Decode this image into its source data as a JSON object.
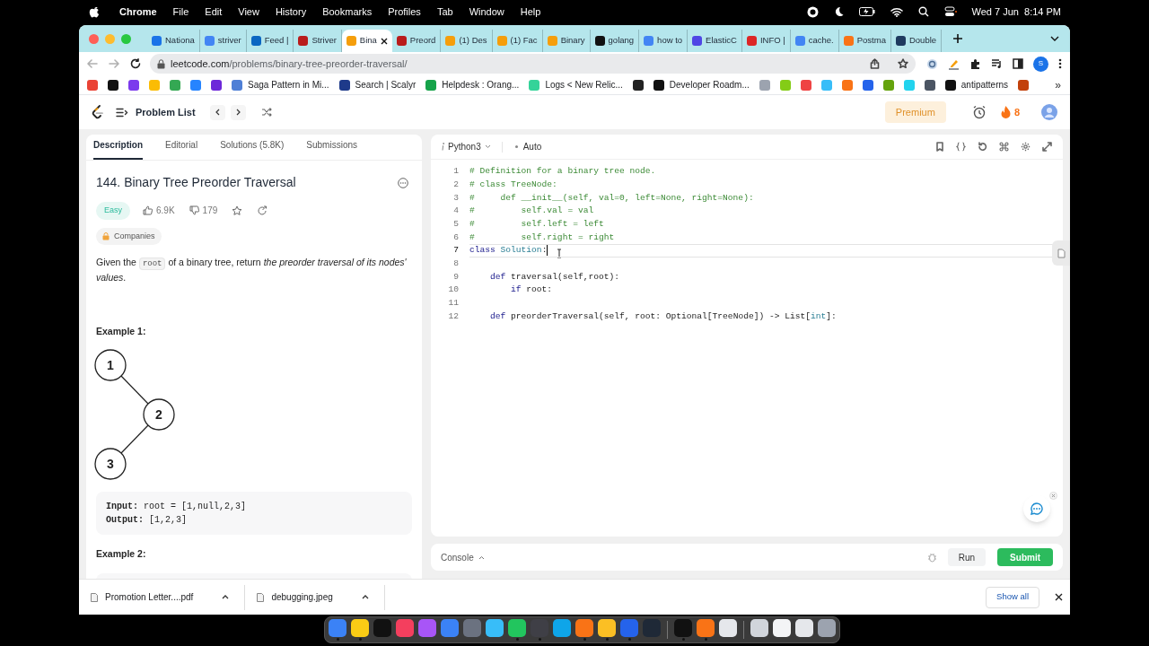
{
  "menu_bar": {
    "app": "Chrome",
    "menus": [
      "File",
      "Edit",
      "View",
      "History",
      "Bookmarks",
      "Profiles",
      "Tab",
      "Window",
      "Help"
    ],
    "clock": "Wed 7 Jun  8:14 PM"
  },
  "browser": {
    "tabs": [
      {
        "label": "Nationa",
        "color": "#1a73e8",
        "selected": false
      },
      {
        "label": "striver",
        "color": "#4285f4",
        "selected": false
      },
      {
        "label": "Feed |",
        "color": "#0a66c2",
        "selected": false
      },
      {
        "label": "Striver",
        "color": "#b91c1c",
        "selected": false
      },
      {
        "label": "Bina",
        "color": "#f59e0b",
        "selected": true
      },
      {
        "label": "Preord",
        "color": "#b91c1c",
        "selected": false
      },
      {
        "label": "(1) Des",
        "color": "#f59e0b",
        "selected": false
      },
      {
        "label": "(1) Fac",
        "color": "#f59e0b",
        "selected": false
      },
      {
        "label": "Binary",
        "color": "#f59e0b",
        "selected": false
      },
      {
        "label": "golang",
        "color": "#111111",
        "selected": false
      },
      {
        "label": "how to",
        "color": "#4285f4",
        "selected": false
      },
      {
        "label": "ElasticC",
        "color": "#4f46e5",
        "selected": false
      },
      {
        "label": "INFO |",
        "color": "#dc2626",
        "selected": false
      },
      {
        "label": "cache.",
        "color": "#4285f4",
        "selected": false
      },
      {
        "label": "Postma",
        "color": "#f97316",
        "selected": false
      },
      {
        "label": "Double",
        "color": "#1e3a5f",
        "selected": false
      }
    ],
    "url": {
      "host": "leetcode.com",
      "path": "/problems/binary-tree-preorder-traversal/"
    },
    "profile_initial": "S",
    "bookmarks": [
      {
        "color": "#ea4335"
      },
      {
        "color": "#111111"
      },
      {
        "color": "#7c3aed"
      },
      {
        "color": "#fbbc04"
      },
      {
        "color": "#34a853"
      },
      {
        "color": "#2684ff"
      },
      {
        "color": "#6d28d9"
      },
      {
        "label": "Saga Pattern in Mi...",
        "color": "#4f7fd6"
      },
      {
        "label": "Search | Scalyr",
        "color": "#1e3a8a"
      },
      {
        "label": "Helpdesk : Orang...",
        "color": "#16a34a"
      },
      {
        "label": "Logs < New Relic...",
        "color": "#34d399"
      },
      {
        "color": "#222222"
      },
      {
        "label": "Developer Roadm...",
        "color": "#111111"
      },
      {
        "color": "#9ca3af"
      },
      {
        "color": "#84cc16"
      },
      {
        "color": "#ef4444"
      },
      {
        "color": "#38bdf8"
      },
      {
        "color": "#f97316"
      },
      {
        "color": "#2563eb"
      },
      {
        "color": "#65a30d"
      },
      {
        "color": "#22d3ee"
      },
      {
        "color": "#4b5563"
      },
      {
        "label": "antipatterns",
        "color": "#111111"
      },
      {
        "color": "#c2410c"
      }
    ],
    "bookmarks_more": "»"
  },
  "header": {
    "title": "Problem List",
    "premium": "Premium",
    "streak": "8"
  },
  "description": {
    "tabs": [
      {
        "label": "Description",
        "selected": true
      },
      {
        "label": "Editorial",
        "selected": false
      },
      {
        "label": "Solutions (5.8K)",
        "selected": false
      },
      {
        "label": "Submissions",
        "selected": false
      }
    ],
    "title": "144. Binary Tree Preorder Traversal",
    "difficulty": "Easy",
    "likes": "6.9K",
    "dislikes": "179",
    "companies": "Companies",
    "statement": [
      {
        "kind": "text",
        "text": "Given the "
      },
      {
        "kind": "code",
        "text": "root"
      },
      {
        "kind": "text",
        "text": " of a binary tree, return *the preorder traversal of its nodes' values*."
      }
    ],
    "example_1": {
      "heading": "Example 1:",
      "tree": [
        "1",
        "2",
        "3"
      ],
      "input": "**Input:** root = [1,null,2,3]",
      "output": "**Output:** [1,2,3]"
    },
    "example_2": {
      "heading": "Example 2:"
    }
  },
  "editor": {
    "language": "Python3",
    "mode": "Auto",
    "lines": [
      {
        "number": "1",
        "current": false,
        "tokens": [
          {
            "kind": "comment",
            "text": "# Definition for a binary tree node."
          }
        ]
      },
      {
        "number": "2",
        "current": false,
        "tokens": [
          {
            "kind": "comment",
            "text": "# class TreeNode:"
          }
        ]
      },
      {
        "number": "3",
        "current": false,
        "tokens": [
          {
            "kind": "comment",
            "text": "#     def __init__(self, val=0, left=None, right=None):"
          }
        ]
      },
      {
        "number": "4",
        "current": false,
        "tokens": [
          {
            "kind": "comment",
            "text": "#         self.val = val"
          }
        ]
      },
      {
        "number": "5",
        "current": false,
        "tokens": [
          {
            "kind": "comment",
            "text": "#         self.left = left"
          }
        ]
      },
      {
        "number": "6",
        "current": false,
        "tokens": [
          {
            "kind": "comment",
            "text": "#         self.right = right"
          }
        ]
      },
      {
        "number": "7",
        "current": true,
        "tokens": [
          {
            "kind": "keyword",
            "text": "class"
          },
          {
            "kind": "type",
            "text": " Solution"
          },
          {
            "kind": "plain",
            "text": ":"
          }
        ]
      },
      {
        "number": "8",
        "current": false
      },
      {
        "number": "9",
        "current": false,
        "tokens": [
          {
            "kind": "keyword",
            "text": "    def"
          },
          {
            "kind": "plain",
            "text": " traversal(self,root):"
          }
        ]
      },
      {
        "number": "10",
        "current": false,
        "tokens": [
          {
            "kind": "keyword",
            "text": "        if"
          },
          {
            "kind": "plain",
            "text": " root:"
          }
        ]
      },
      {
        "number": "11",
        "current": false
      },
      {
        "number": "12",
        "current": false,
        "tokens": [
          {
            "kind": "keyword",
            "text": "    def"
          },
          {
            "kind": "plain",
            "text": " preorderTraversal(self, root: Optional[TreeNode]) -> List["
          },
          {
            "kind": "type",
            "text": "int"
          },
          {
            "kind": "plain",
            "text": "]:"
          }
        ]
      }
    ]
  },
  "console": {
    "label": "Console",
    "run": "Run",
    "submit": "Submit"
  },
  "downloads": {
    "files": [
      "Promotion Letter....pdf",
      "debugging.jpeg"
    ],
    "show_all": "Show all"
  },
  "dock": {
    "groups": [
      [
        {
          "color": "#3b82f6",
          "running": true
        },
        {
          "color": "#facc15",
          "running": true
        },
        {
          "color": "#111111",
          "running": false
        },
        {
          "color": "#f43f5e",
          "running": false
        },
        {
          "color": "#a855f7",
          "running": false
        },
        {
          "color": "#3b82f6",
          "running": false
        },
        {
          "color": "#6b7280",
          "running": false
        },
        {
          "color": "#38bdf8",
          "running": false
        },
        {
          "color": "#22c55e",
          "running": true
        },
        {
          "color": "#3f3f46",
          "running": true
        },
        {
          "color": "#0ea5e9",
          "running": false
        },
        {
          "color": "#f97316",
          "running": true
        },
        {
          "color": "#fbbf24",
          "running": true
        },
        {
          "color": "#2563eb",
          "running": true
        },
        {
          "color": "#1f2937",
          "running": false
        }
      ],
      [
        {
          "color": "#111111",
          "running": true
        },
        {
          "color": "#f97316",
          "running": true
        },
        {
          "color": "#e5e7eb",
          "running": false
        }
      ],
      [
        {
          "color": "#d1d5db",
          "running": false
        },
        {
          "color": "#f3f4f6",
          "running": false
        },
        {
          "color": "#e5e7eb",
          "running": false
        },
        {
          "color": "#9ca3af",
          "running": false
        }
      ]
    ]
  }
}
